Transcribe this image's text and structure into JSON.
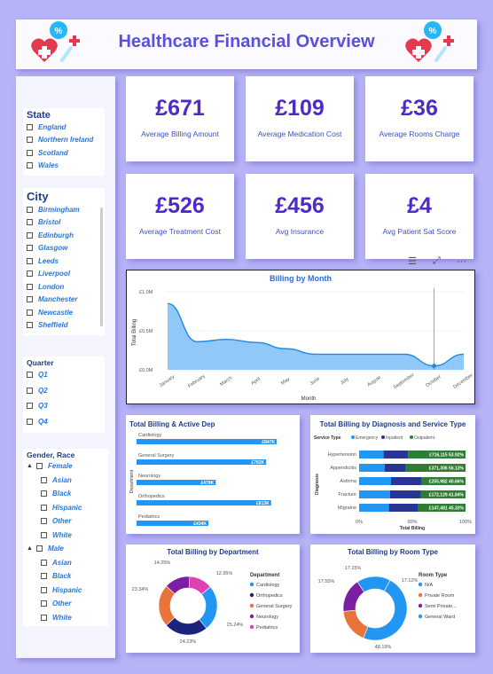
{
  "header": {
    "title": "Healthcare Financial Overview"
  },
  "filters": {
    "state": {
      "title": "State",
      "items": [
        "England",
        "Northern Ireland",
        "Scotland",
        "Wales"
      ]
    },
    "city": {
      "title": "City",
      "items": [
        "Birmingham",
        "Bristol",
        "Edinburgh",
        "Glasgow",
        "Leeds",
        "Liverpool",
        "London",
        "Manchester",
        "Newcastle",
        "Sheffield"
      ]
    },
    "quarter": {
      "title": "Quarter",
      "items": [
        "Q1",
        "Q2",
        "Q3",
        "Q4"
      ]
    },
    "gender_race": {
      "title": "Gender, Race",
      "groups": [
        {
          "label": "Female",
          "items": [
            "Asian",
            "Black",
            "Hispanic",
            "Other",
            "White"
          ]
        },
        {
          "label": "Male",
          "items": [
            "Asian",
            "Black",
            "Hispanic",
            "Other",
            "White"
          ]
        }
      ]
    }
  },
  "kpis": [
    {
      "value": "£671",
      "label": "Average Billing Amount"
    },
    {
      "value": "£109",
      "label": "Average Medication Cost"
    },
    {
      "value": "£36",
      "label": "Average Rooms Charge"
    },
    {
      "value": "£526",
      "label": "Average Treatment Cost"
    },
    {
      "value": "£456",
      "label": "Avg Insurance"
    },
    {
      "value": "£4",
      "label": "Avg Patient Sat Score"
    }
  ],
  "colors": {
    "accent": "#5a4fe0",
    "kpi_value": "#4f2ac9",
    "blue": "#2196f3",
    "navy": "#1a237e",
    "green": "#2e7d32",
    "orange": "#e8743b",
    "purple": "#7b1fa2",
    "pink": "#e040b0"
  },
  "chart_data": [
    {
      "type": "area",
      "title": "Billing by Month",
      "xlabel": "Month",
      "ylabel": "Total Billing",
      "yticks": [
        "£0.0M",
        "£0.5M",
        "£1.0M"
      ],
      "ylim": [
        0,
        1.0
      ],
      "categories": [
        "January",
        "February",
        "March",
        "April",
        "May",
        "June",
        "July",
        "August",
        "September",
        "October",
        "December"
      ],
      "values": [
        0.85,
        0.36,
        0.39,
        0.35,
        0.27,
        0.2,
        0.2,
        0.2,
        0.2,
        0.05,
        0.2
      ]
    },
    {
      "type": "bar",
      "title": "Total Billing & Active Dep",
      "ylabel": "Department",
      "categories": [
        "Cardiology",
        "General Surgery",
        "Neurology",
        "Orthopedics",
        "Pediatrics"
      ],
      "values": [
        847,
        783,
        478,
        813,
        434
      ],
      "labels": [
        "£847K",
        "£783K",
        "£478K",
        "£813K",
        "£434K"
      ]
    },
    {
      "type": "bar",
      "title": "Total Billing by Diagnosis and Service Type",
      "legend_title": "Service Type",
      "legend": [
        "Emergency",
        "Inpatient",
        "Outpatient"
      ],
      "ylabel": "Diagnosis",
      "xlabel": "Total Billing",
      "xticks": [
        "0%",
        "50%",
        "100%"
      ],
      "categories": [
        "Hypertension",
        "Appendicitis",
        "Asthma",
        "Fracture",
        "Migraine"
      ],
      "series": [
        {
          "name": "Emergency",
          "values": [
            23,
            24,
            30,
            29,
            28
          ]
        },
        {
          "name": "Inpatient",
          "values": [
            23,
            20,
            29,
            29,
            27
          ]
        },
        {
          "name": "Outpatient",
          "values": [
            54,
            56,
            41,
            42,
            45
          ]
        }
      ],
      "labels": [
        "£716,115 53.92%",
        "£371,306 56.13%",
        "£255,982 40.66%",
        "£172,129 41.84%",
        "£147,481 45.32%"
      ]
    },
    {
      "type": "pie",
      "title": "Total Billing by Department",
      "legend_title": "Department",
      "categories": [
        "Cardiology",
        "Orthopedics",
        "General Surgery",
        "Neurology",
        "Pediatrics"
      ],
      "values": [
        25.24,
        24.23,
        23.34,
        14.25,
        12.95
      ],
      "labels": [
        "25.24%",
        "24.23%",
        "23.34%",
        "14.25%",
        "12.95%"
      ]
    },
    {
      "type": "pie",
      "title": "Total Billing by Room Type",
      "legend_title": "Room Type",
      "categories": [
        "N/A",
        "Private Room",
        "Semi Private...",
        "General Ward"
      ],
      "values": [
        48.19,
        17.55,
        17.15,
        17.12
      ],
      "labels": [
        "48.19%",
        "17.55%",
        "17.15%",
        "17.12%"
      ]
    }
  ]
}
